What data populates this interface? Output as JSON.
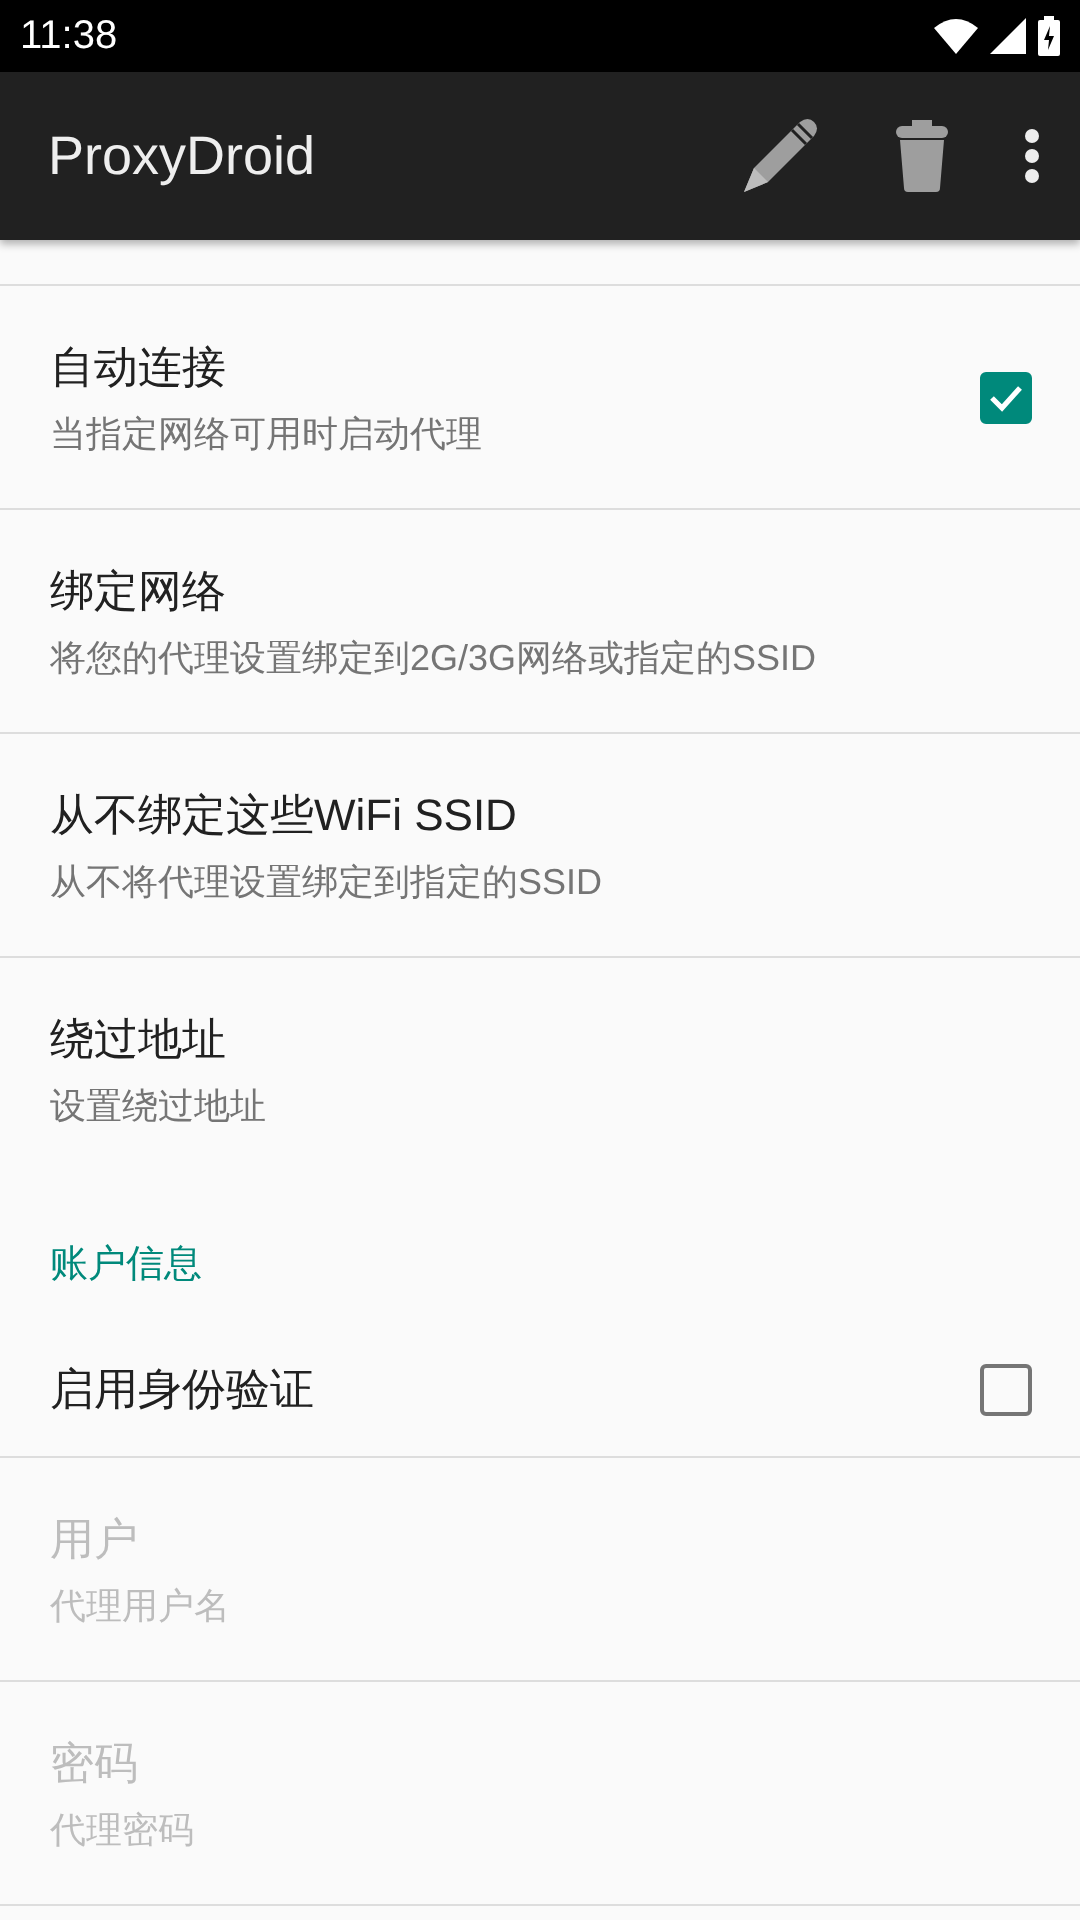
{
  "status_bar": {
    "time": "11:38"
  },
  "toolbar": {
    "title": "ProxyDroid"
  },
  "preferences": [
    {
      "kind": "checkbox",
      "title": "自动连接",
      "summary": "当指定网络可用时启动代理",
      "checked": true,
      "disabled": false
    },
    {
      "kind": "preference",
      "title": "绑定网络",
      "summary": "将您的代理设置绑定到2G/3G网络或指定的SSID",
      "disabled": false
    },
    {
      "kind": "preference",
      "title": "从不绑定这些WiFi SSID",
      "summary": "从不将代理设置绑定到指定的SSID",
      "disabled": false
    },
    {
      "kind": "preference",
      "title": "绕过地址",
      "summary": "设置绕过地址",
      "disabled": false
    },
    {
      "kind": "category",
      "title": "账户信息"
    },
    {
      "kind": "checkbox",
      "title": "启用身份验证",
      "checked": false,
      "disabled": false
    },
    {
      "kind": "preference",
      "title": "用户",
      "summary": "代理用户名",
      "disabled": true
    },
    {
      "kind": "preference",
      "title": "密码",
      "summary": "代理密码",
      "disabled": true
    }
  ]
}
